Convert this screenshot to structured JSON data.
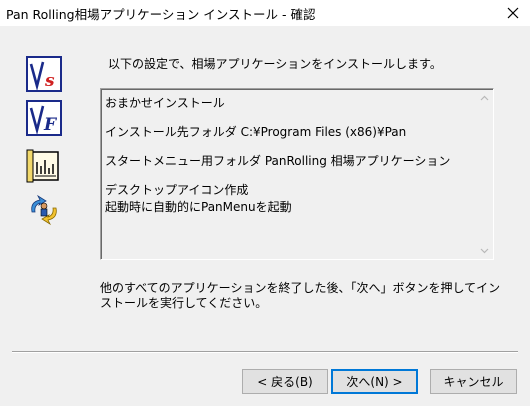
{
  "window": {
    "title": "Pan Rolling相場アプリケーション インストール - 確認"
  },
  "intro_text": "以下の設定で、相場アプリケーションをインストールします。",
  "summary": {
    "lines": [
      "おまかせインストール",
      "インストール先フォルダ  C:¥Program Files (x86)¥Pan",
      "スタートメニュー用フォルダ  PanRolling 相場アプリケーション",
      "デスクトップアイコン作成",
      "起動時に自動的にPanMenuを起動"
    ]
  },
  "instruction_text": "他のすべてのアプリケーションを終了した後、「次へ」ボタンを押してインストールを実行してください。",
  "buttons": {
    "back": "< 戻る(B)",
    "next": "次へ(N) >",
    "cancel": "キャンセル"
  },
  "icons": {
    "close": "close-icon",
    "vs": "vs-app-icon",
    "vf": "vf-app-icon",
    "chart": "chart-app-icon",
    "person": "person-app-icon"
  },
  "colors": {
    "accent": "#0078d7",
    "icon_red": "#d02020",
    "icon_blue": "#1a2a8a"
  }
}
